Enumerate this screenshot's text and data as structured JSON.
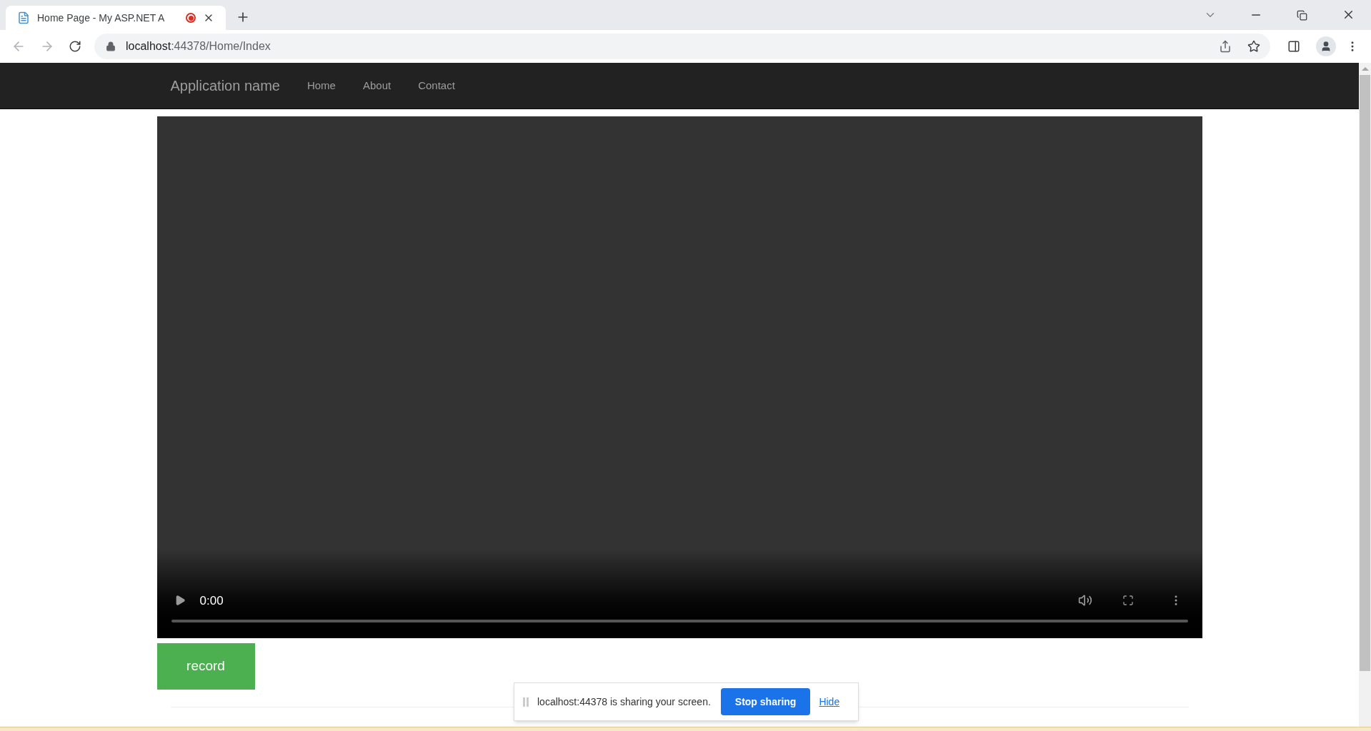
{
  "browser": {
    "tab": {
      "title": "Home Page - My ASP.NET A",
      "recording": true,
      "selected": true
    },
    "address": {
      "host": "localhost",
      "path": ":44378/Home/Index"
    }
  },
  "navbar": {
    "brand": "Application name",
    "links": [
      "Home",
      "About",
      "Contact"
    ]
  },
  "video": {
    "time": "0:00"
  },
  "record_button": "record",
  "sharing_bar": {
    "message": "localhost:44378 is sharing your screen.",
    "stop_button": "Stop sharing",
    "hide_link": "Hide"
  }
}
